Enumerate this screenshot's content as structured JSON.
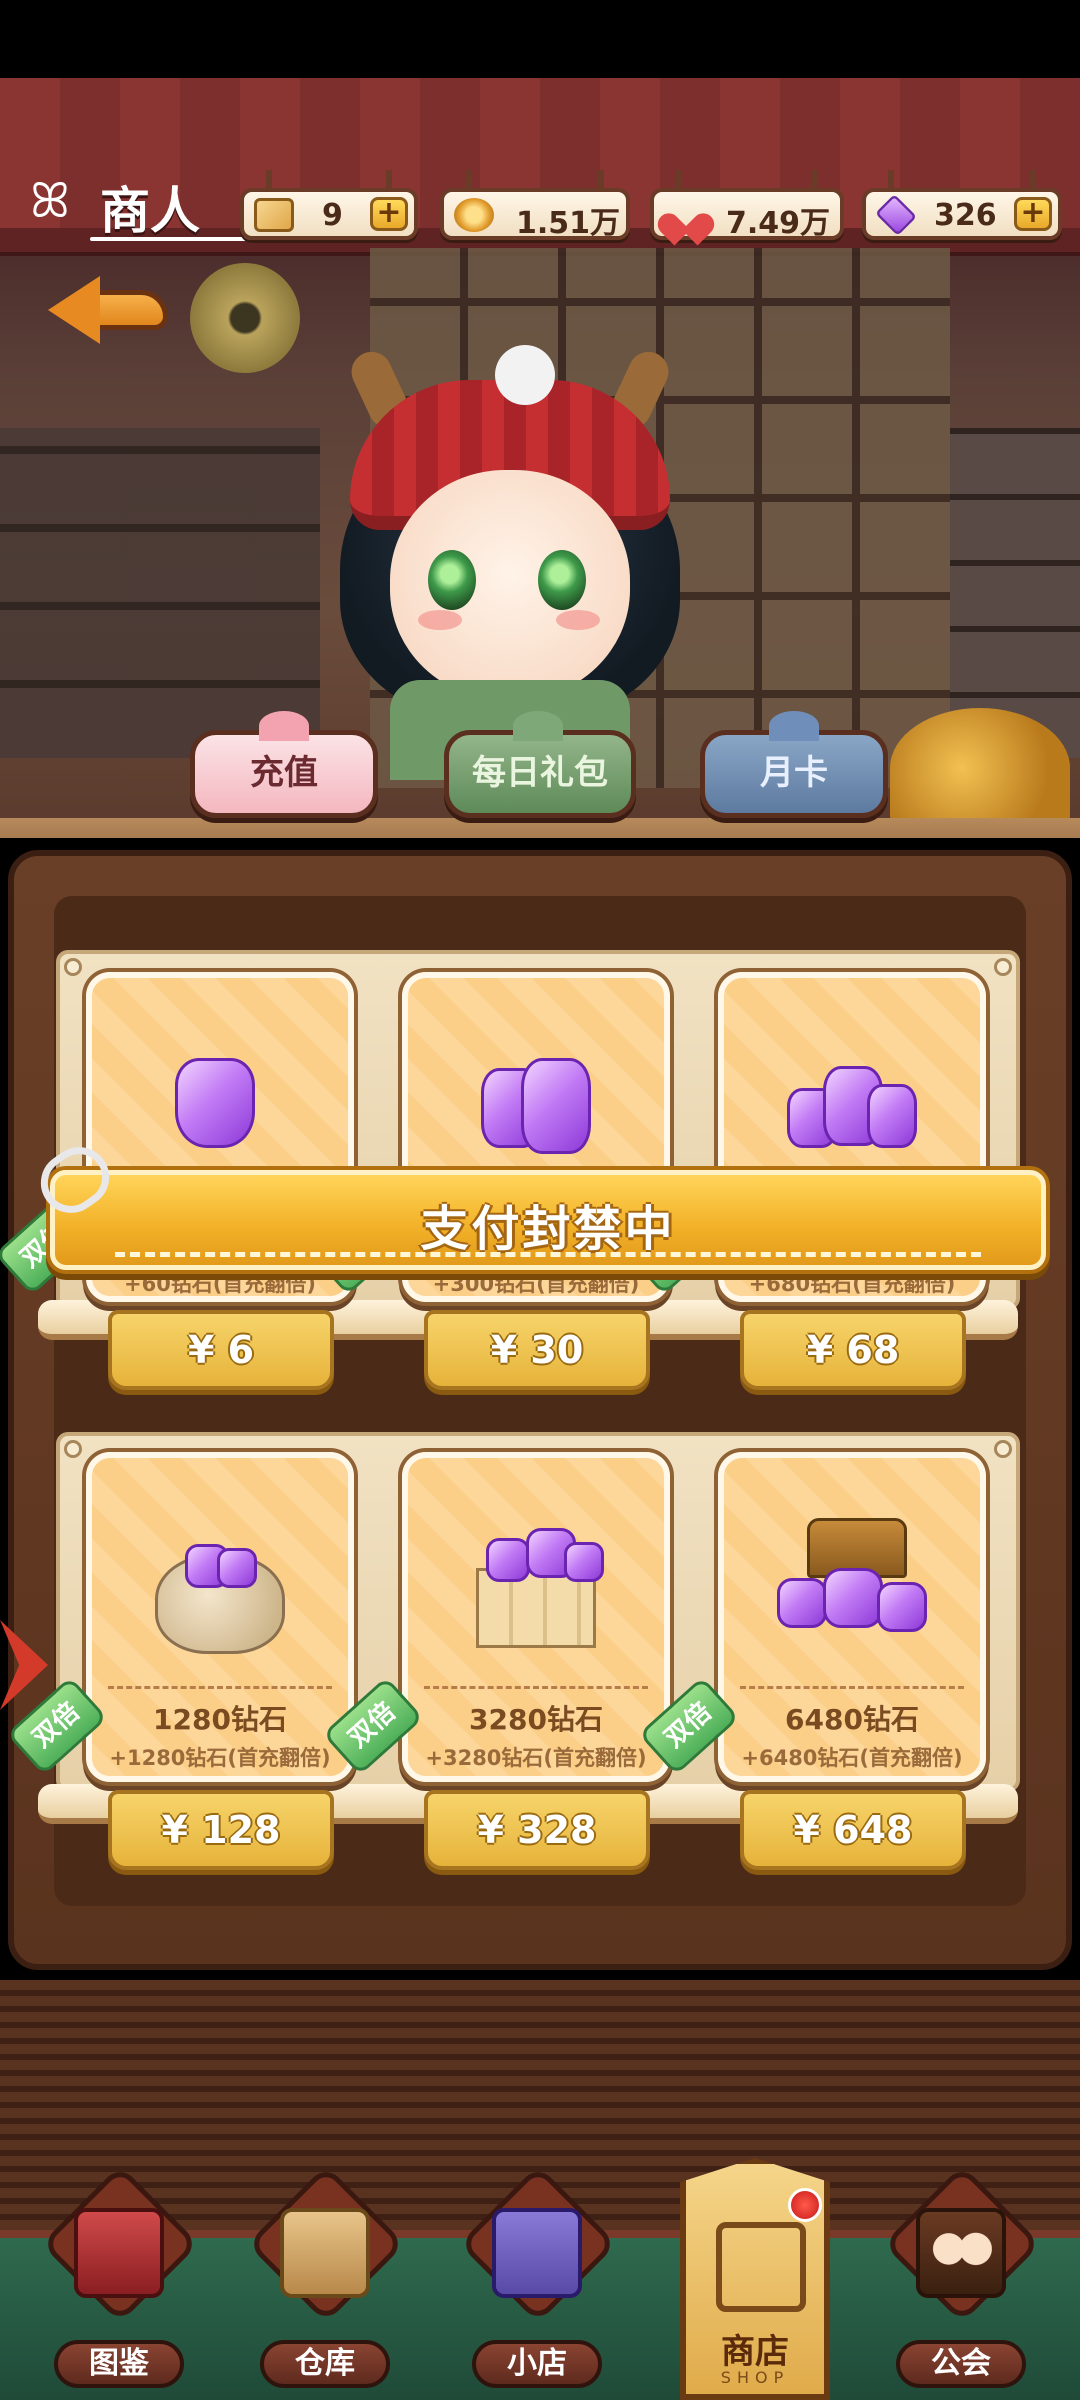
{
  "header": {
    "title": "商人",
    "resources": [
      {
        "name": "ticket",
        "value": "9",
        "has_plus": true
      },
      {
        "name": "coin",
        "value": "1.51万",
        "has_plus": false
      },
      {
        "name": "heart",
        "value": "7.49万",
        "has_plus": false
      },
      {
        "name": "gem",
        "value": "326",
        "has_plus": true
      }
    ],
    "plus_label": "+"
  },
  "tabs": [
    {
      "label": "充值",
      "color": "#f4b7bf"
    },
    {
      "label": "每日礼包",
      "color": "#5e8a58"
    },
    {
      "label": "月卡",
      "color": "#5d7aa0"
    }
  ],
  "products": [
    {
      "amount": "",
      "bonus": "+60钻石(首充翻倍)",
      "price": "¥ 6",
      "tag": "双倍"
    },
    {
      "amount": "",
      "bonus": "+300钻石(首充翻倍)",
      "price": "¥ 30",
      "tag": "双倍"
    },
    {
      "amount": "",
      "bonus": "+680钻石(首充翻倍)",
      "price": "¥ 68",
      "tag": "双倍"
    },
    {
      "amount": "1280钻石",
      "bonus": "+1280钻石(首充翻倍)",
      "price": "¥ 128",
      "tag": "双倍"
    },
    {
      "amount": "3280钻石",
      "bonus": "+3280钻石(首充翻倍)",
      "price": "¥ 328",
      "tag": "双倍"
    },
    {
      "amount": "6480钻石",
      "bonus": "+6480钻石(首充翻倍)",
      "price": "¥ 648",
      "tag": "双倍"
    }
  ],
  "banner": {
    "text": "支付封禁中"
  },
  "nav": {
    "items": [
      {
        "label": "图鉴",
        "icon": "book-icon"
      },
      {
        "label": "仓库",
        "icon": "box-icon"
      },
      {
        "label": "小店",
        "icon": "house-icon"
      },
      {
        "label": "公会",
        "icon": "friends-icon"
      }
    ],
    "shop": {
      "label": "商店",
      "sub": "SHOP",
      "icon": "shop-icon",
      "has_badge": true
    }
  },
  "colors": {
    "accent_gold": "#f3b32a",
    "gem_purple": "#9a48e0",
    "badge_red": "#c81a1a"
  }
}
